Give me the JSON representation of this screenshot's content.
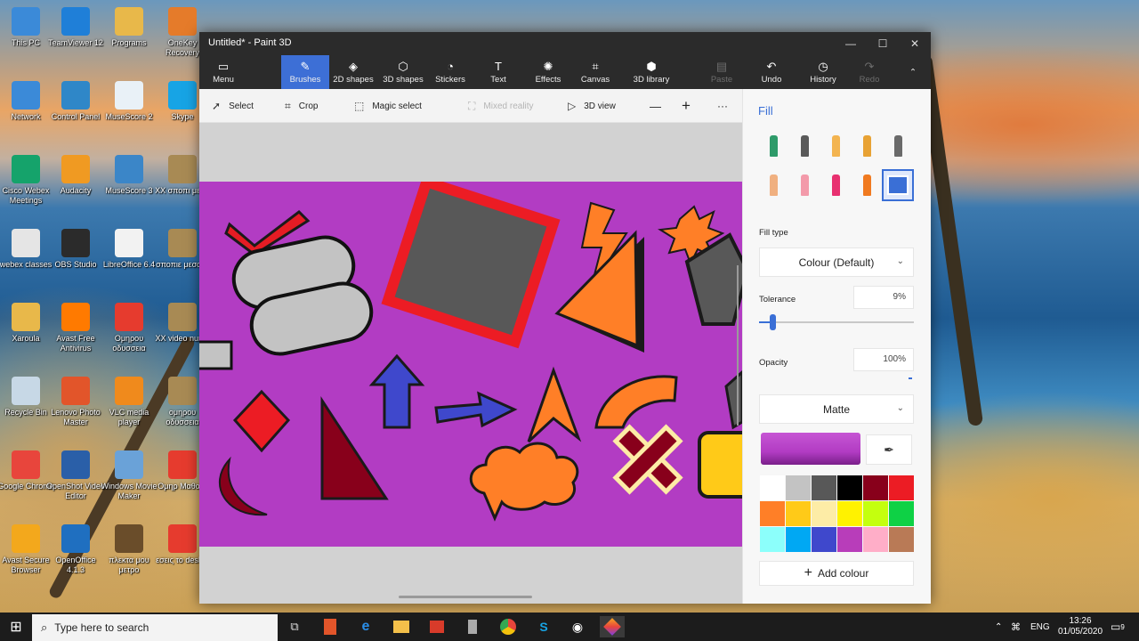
{
  "desktop_icons": [
    {
      "label": "This PC",
      "icon": "computer-icon",
      "color": "#3b8ad8"
    },
    {
      "label": "TeamViewer 12",
      "icon": "teamviewer-icon",
      "color": "#1f7fd8"
    },
    {
      "label": "Programs",
      "icon": "folder-icon",
      "color": "#e8b84a"
    },
    {
      "label": "OneKey Recovery",
      "icon": "onekey-icon",
      "color": "#e57b2a"
    },
    {
      "label": "Network",
      "icon": "network-icon",
      "color": "#3b8ad8"
    },
    {
      "label": "Control Panel",
      "icon": "control-panel-icon",
      "color": "#2f87c8"
    },
    {
      "label": "MuseScore 2",
      "icon": "musescore-icon",
      "color": "#e9f1f7"
    },
    {
      "label": "Skype",
      "icon": "skype-icon",
      "color": "#17a4e5"
    },
    {
      "label": "Cisco Webex Meetings",
      "icon": "webex-icon",
      "color": "#15a36b"
    },
    {
      "label": "Audacity",
      "icon": "audacity-icon",
      "color": "#f09a22"
    },
    {
      "label": "MuseScore 3",
      "icon": "musescore-icon",
      "color": "#3b86c8"
    },
    {
      "label": "XX σποπι μεσα",
      "icon": "folder-icon",
      "color": "#a88a54"
    },
    {
      "label": "webex classes",
      "icon": "file-icon",
      "color": "#e5e5e5"
    },
    {
      "label": "OBS Studio",
      "icon": "obs-icon",
      "color": "#2b2b2b"
    },
    {
      "label": "LibreOffice 6.4",
      "icon": "file-icon",
      "color": "#f2f2f2"
    },
    {
      "label": "σποπιε μεσα X",
      "icon": "folder-icon",
      "color": "#a88a54"
    },
    {
      "label": "Xaroula",
      "icon": "folder-icon",
      "color": "#e8b84a"
    },
    {
      "label": "Avast Free Antivirus",
      "icon": "avast-icon",
      "color": "#ff7a00"
    },
    {
      "label": "Ομηρου οδυσσεια",
      "icon": "pdf-icon",
      "color": "#e63b2e"
    },
    {
      "label": "XX video nurse",
      "icon": "folder-icon",
      "color": "#a88a54"
    },
    {
      "label": "Recycle Bin",
      "icon": "recycle-bin-icon",
      "color": "#c7d8e6"
    },
    {
      "label": "Lenovo Photo Master",
      "icon": "lenovo-icon",
      "color": "#e2552a"
    },
    {
      "label": "VLC media player",
      "icon": "vlc-icon",
      "color": "#f08a1c"
    },
    {
      "label": "ομηρου οδυσσεια",
      "icon": "folder-icon",
      "color": "#a88a54"
    },
    {
      "label": "Google Chrome",
      "icon": "chrome-icon",
      "color": "#e8453c"
    },
    {
      "label": "OpenShot Video Editor",
      "icon": "openshot-icon",
      "color": "#2a5fa8"
    },
    {
      "label": "Windows Movie Maker",
      "icon": "moviemaker-icon",
      "color": "#6aa2d8"
    },
    {
      "label": "Ομηρ Μαθα α",
      "icon": "pdf-icon",
      "color": "#e63b2e"
    },
    {
      "label": "Avast Secure Browser",
      "icon": "avast-browser-icon",
      "color": "#f3a81c"
    },
    {
      "label": "OpenOffice 4.1.3",
      "icon": "openoffice-icon",
      "color": "#1f6fc0"
    },
    {
      "label": "πλεκτα μου μετρο",
      "icon": "file-icon",
      "color": "#6a4d2a"
    },
    {
      "label": "εσεις το deskto",
      "icon": "file-icon",
      "color": "#e63b2e"
    }
  ],
  "window": {
    "title": "Untitled* - Paint 3D",
    "minimize": "—",
    "maximize": "☐",
    "close": "✕"
  },
  "ribbon": [
    {
      "label": "Menu",
      "icon": "menu-icon",
      "glyph": "▭",
      "active": false,
      "disabled": false
    },
    {
      "label": "Brushes",
      "icon": "brush-icon",
      "glyph": "✎",
      "active": true,
      "disabled": false
    },
    {
      "label": "2D shapes",
      "icon": "2d-shapes-icon",
      "glyph": "◈",
      "active": false,
      "disabled": false
    },
    {
      "label": "3D shapes",
      "icon": "3d-shapes-icon",
      "glyph": "⬡",
      "active": false,
      "disabled": false
    },
    {
      "label": "Stickers",
      "icon": "stickers-icon",
      "glyph": "◔",
      "active": false,
      "disabled": false
    },
    {
      "label": "Text",
      "icon": "text-icon",
      "glyph": "T",
      "active": false,
      "disabled": false
    },
    {
      "label": "Effects",
      "icon": "effects-icon",
      "glyph": "✺",
      "active": false,
      "disabled": false
    },
    {
      "label": "Canvas",
      "icon": "canvas-icon",
      "glyph": "⌗",
      "active": false,
      "disabled": false
    },
    {
      "label": "3D library",
      "icon": "3d-library-icon",
      "glyph": "⬢",
      "active": false,
      "disabled": false
    },
    {
      "label": "Paste",
      "icon": "paste-icon",
      "glyph": "▤",
      "active": false,
      "disabled": true
    },
    {
      "label": "Undo",
      "icon": "undo-icon",
      "glyph": "↶",
      "active": false,
      "disabled": false
    },
    {
      "label": "History",
      "icon": "history-icon",
      "glyph": "◷",
      "active": false,
      "disabled": false
    },
    {
      "label": "Redo",
      "icon": "redo-icon",
      "glyph": "↷",
      "active": false,
      "disabled": true
    }
  ],
  "toolbar": {
    "select": "Select",
    "crop": "Crop",
    "magic_select": "Magic select",
    "mixed_reality": "Mixed reality",
    "view_3d": "3D view",
    "zoom_out": "—",
    "zoom_in": "+",
    "more": "···"
  },
  "panel": {
    "title": "Fill",
    "brushes": [
      "marker-icon",
      "calligraphy-pen-icon",
      "oil-brush-icon",
      "watercolor-icon",
      "pixel-pen-icon",
      "pencil-icon",
      "eraser-icon",
      "crayon-icon",
      "spray-can-icon",
      "fill-icon"
    ],
    "selected_brush": 9,
    "fill_type_label": "Fill type",
    "fill_type_value": "Colour (Default)",
    "tolerance_label": "Tolerance",
    "tolerance_value": "9%",
    "tolerance_level": 0.09,
    "opacity_label": "Opacity",
    "opacity_value": "100%",
    "finish_value": "Matte",
    "current_color": "#b23cc3",
    "palette": [
      "#ffffff",
      "#c3c3c3",
      "#585858",
      "#000000",
      "#88001b",
      "#ec1c24",
      "#ff7f27",
      "#ffca18",
      "#fdeca6",
      "#fff200",
      "#c4ff0e",
      "#0ed145",
      "#8cfffb",
      "#00a8f3",
      "#3f48cc",
      "#b83dba",
      "#ffaec8",
      "#b97a56"
    ],
    "add_colour": "Add colour"
  },
  "taskbar": {
    "search_placeholder": "Type here to search",
    "language": "ENG",
    "time": "13:26",
    "date": "01/05/2020",
    "notifications": "9"
  }
}
